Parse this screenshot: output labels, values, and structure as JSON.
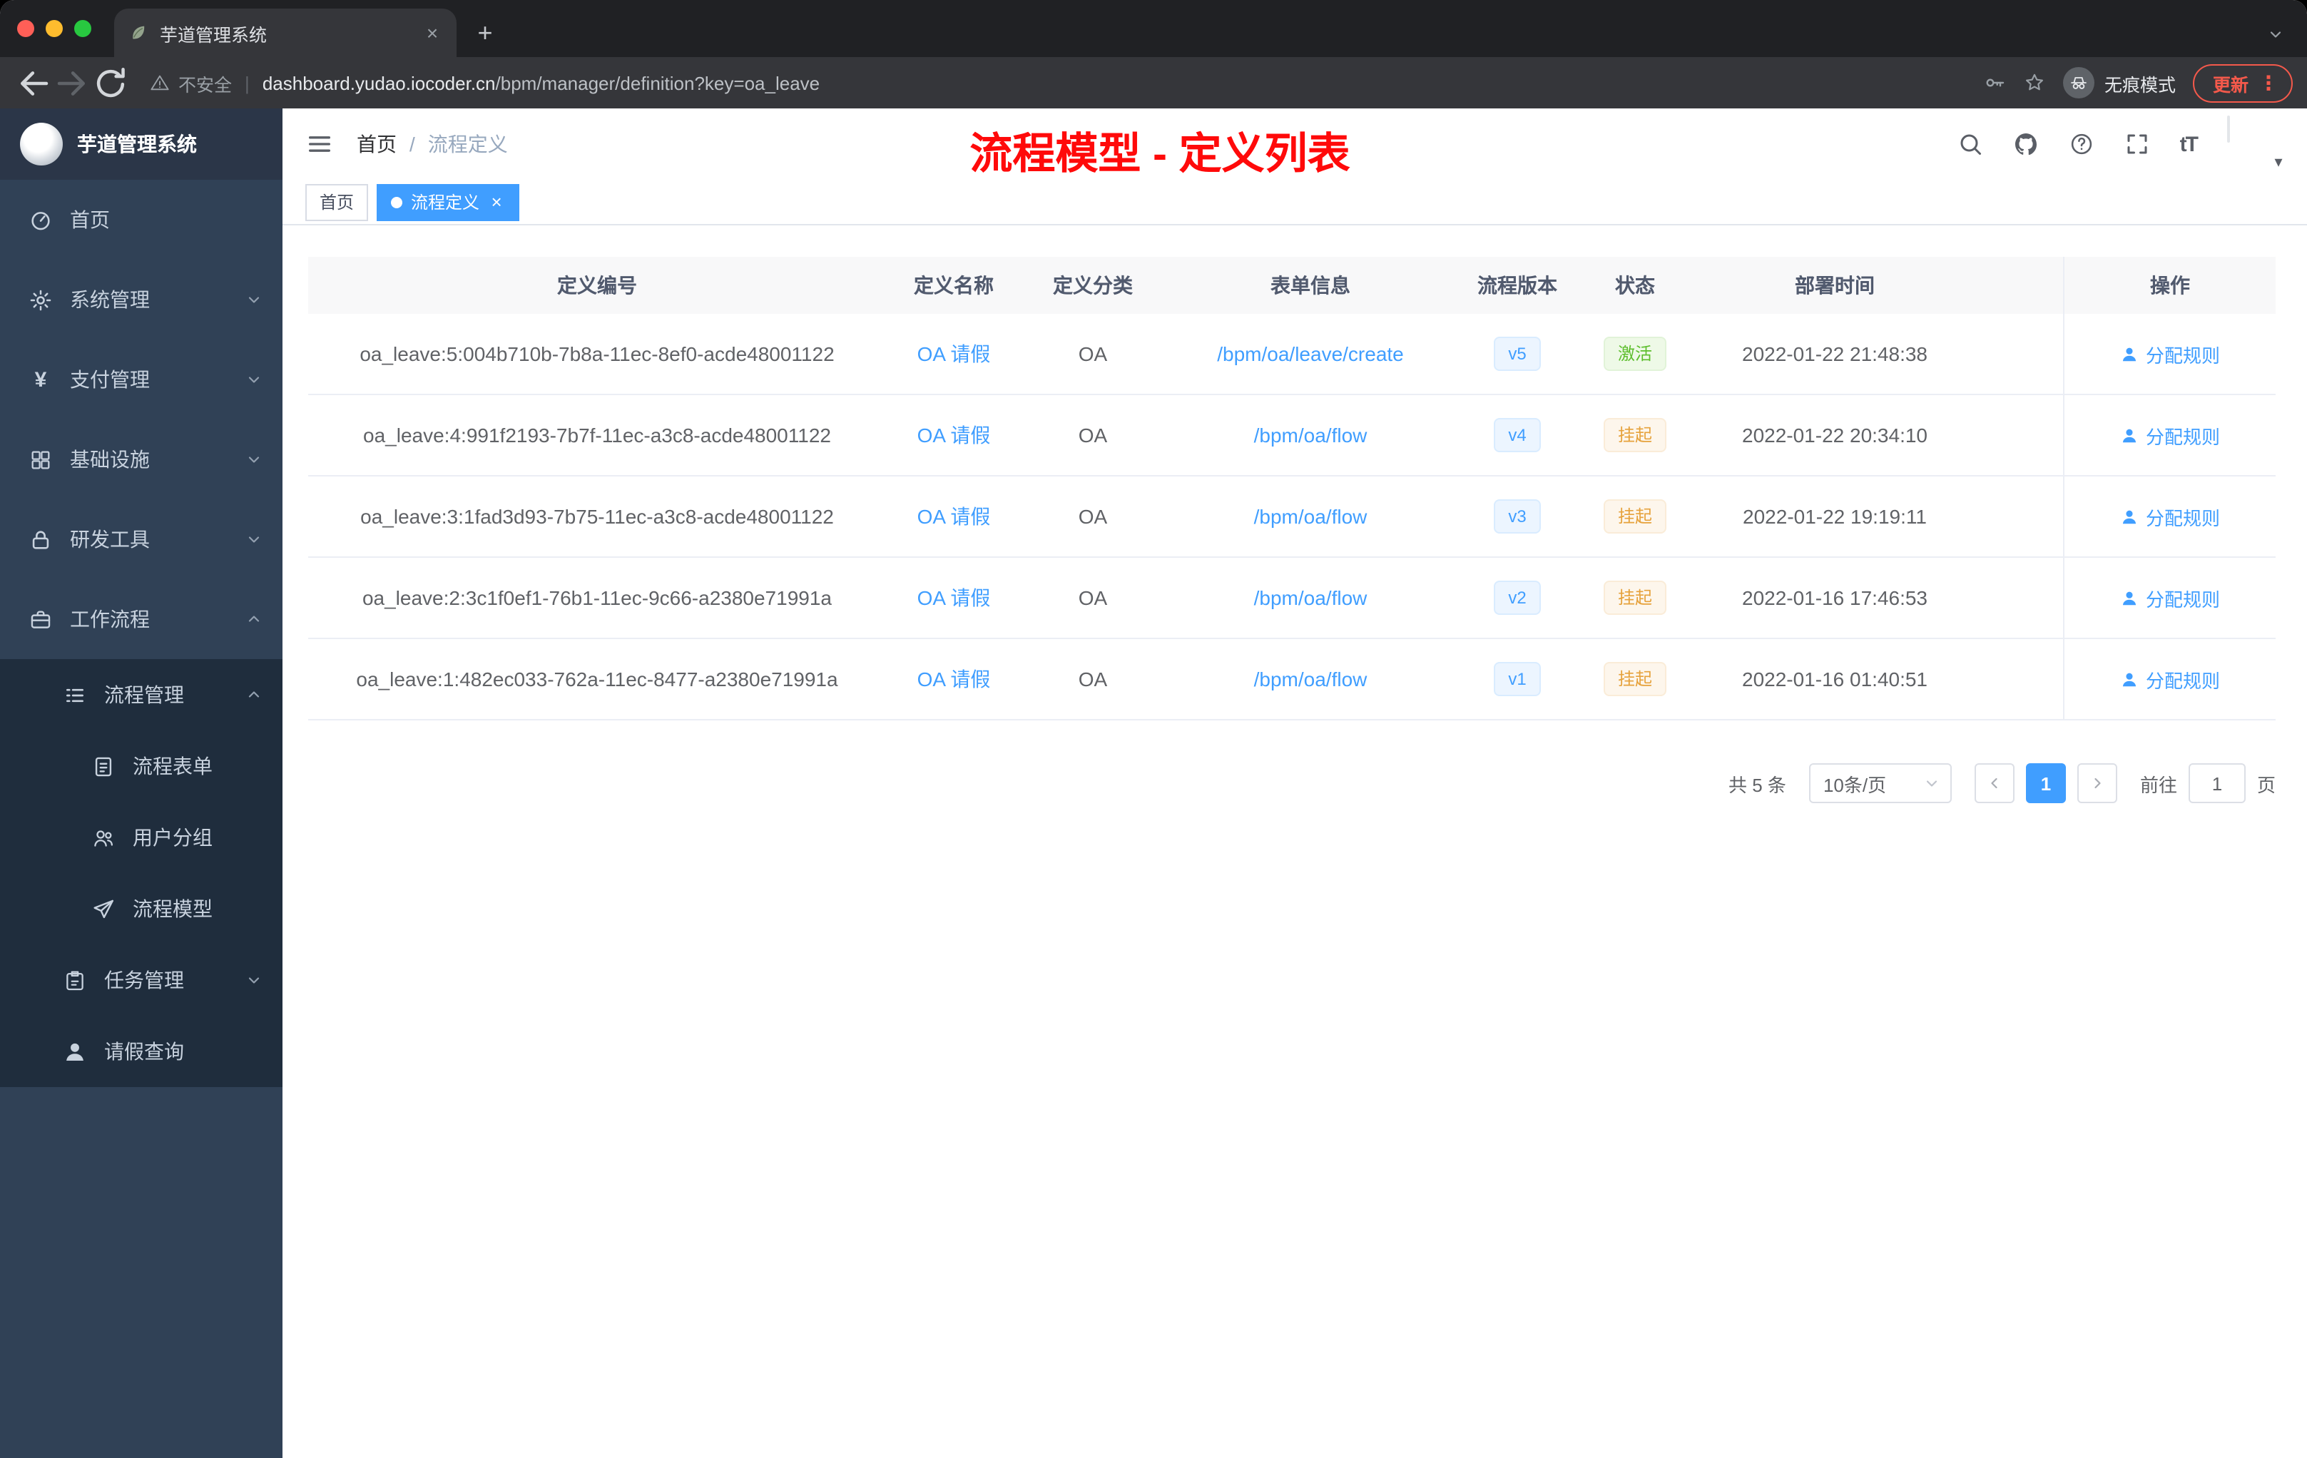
{
  "browser": {
    "tab_title": "芋道管理系统",
    "security_label": "不安全",
    "url_host": "dashboard.yudao.iocoder.cn",
    "url_path": "/bpm/manager/definition?key=oa_leave",
    "incognito_label": "无痕模式",
    "update_label": "更新"
  },
  "sidebar": {
    "logo_title": "芋道管理系统",
    "items": [
      {
        "label": "首页",
        "icon": "dashboard-icon"
      },
      {
        "label": "系统管理",
        "icon": "gear-icon"
      },
      {
        "label": "支付管理",
        "icon": "yen-icon"
      },
      {
        "label": "基础设施",
        "icon": "grid-icon"
      },
      {
        "label": "研发工具",
        "icon": "lock-icon"
      },
      {
        "label": "工作流程",
        "icon": "briefcase-icon"
      }
    ],
    "submenu": [
      {
        "label": "流程管理",
        "icon": "list-icon"
      },
      {
        "label": "流程表单",
        "icon": "form-icon"
      },
      {
        "label": "用户分组",
        "icon": "users-icon"
      },
      {
        "label": "流程模型",
        "icon": "send-icon"
      },
      {
        "label": "任务管理",
        "icon": "task-icon"
      },
      {
        "label": "请假查询",
        "icon": "user-icon"
      }
    ]
  },
  "navbar": {
    "breadcrumb_home": "首页",
    "breadcrumb_sep": "/",
    "breadcrumb_current": "流程定义",
    "annotation": "流程模型 - 定义列表",
    "font_size_glyph": "tT"
  },
  "tags": {
    "home": "首页",
    "active": "流程定义"
  },
  "table": {
    "headers": [
      "定义编号",
      "定义名称",
      "定义分类",
      "表单信息",
      "流程版本",
      "状态",
      "部署时间",
      "操作"
    ],
    "rows": [
      {
        "id": "oa_leave:5:004b710b-7b8a-11ec-8ef0-acde48001122",
        "name": "OA 请假",
        "category": "OA",
        "form": "/bpm/oa/leave/create",
        "version": "v5",
        "status": "激活",
        "status_type": "success",
        "deployed": "2022-01-22 21:48:38",
        "action": "分配规则"
      },
      {
        "id": "oa_leave:4:991f2193-7b7f-11ec-a3c8-acde48001122",
        "name": "OA 请假",
        "category": "OA",
        "form": "/bpm/oa/flow",
        "version": "v4",
        "status": "挂起",
        "status_type": "warning",
        "deployed": "2022-01-22 20:34:10",
        "action": "分配规则"
      },
      {
        "id": "oa_leave:3:1fad3d93-7b75-11ec-a3c8-acde48001122",
        "name": "OA 请假",
        "category": "OA",
        "form": "/bpm/oa/flow",
        "version": "v3",
        "status": "挂起",
        "status_type": "warning",
        "deployed": "2022-01-22 19:19:11",
        "action": "分配规则"
      },
      {
        "id": "oa_leave:2:3c1f0ef1-76b1-11ec-9c66-a2380e71991a",
        "name": "OA 请假",
        "category": "OA",
        "form": "/bpm/oa/flow",
        "version": "v2",
        "status": "挂起",
        "status_type": "warning",
        "deployed": "2022-01-16 17:46:53",
        "action": "分配规则"
      },
      {
        "id": "oa_leave:1:482ec033-762a-11ec-8477-a2380e71991a",
        "name": "OA 请假",
        "category": "OA",
        "form": "/bpm/oa/flow",
        "version": "v1",
        "status": "挂起",
        "status_type": "warning",
        "deployed": "2022-01-16 01:40:51",
        "action": "分配规则"
      }
    ]
  },
  "pagination": {
    "total": "共 5 条",
    "page_size": "10条/页",
    "current_page": "1",
    "goto_label": "前往",
    "goto_value": "1",
    "page_unit": "页"
  },
  "icons": [
    "leaf-favicon-icon",
    "close-icon",
    "plus-icon",
    "chevron-down-icon",
    "back-icon",
    "forward-icon",
    "reload-icon",
    "warning-icon",
    "key-icon",
    "star-icon",
    "incognito-icon",
    "dots-vertical-icon",
    "hamburger-icon",
    "search-icon",
    "github-icon",
    "question-icon",
    "fullscreen-icon",
    "font-size-icon",
    "caret-down-icon",
    "dashboard-icon",
    "gear-icon",
    "yen-icon",
    "grid-icon",
    "lock-icon",
    "briefcase-icon",
    "list-icon",
    "form-icon",
    "users-icon",
    "send-icon",
    "task-icon",
    "user-icon",
    "chevron-left-icon",
    "chevron-right-icon"
  ],
  "colors": {
    "accent": "#409eff",
    "success_text": "#5dbe2d",
    "warning_text": "#e6a23c",
    "annotation": "#ff0a0a",
    "sidebar_bg": "#304156",
    "submenu_bg": "#1f2d3d",
    "chrome_dark": "#202124",
    "chrome_toolbar": "#35363a",
    "update_red": "#f4594b",
    "traffic_red": "#ff5f57",
    "traffic_yellow": "#febc2e",
    "traffic_green": "#28c840"
  }
}
